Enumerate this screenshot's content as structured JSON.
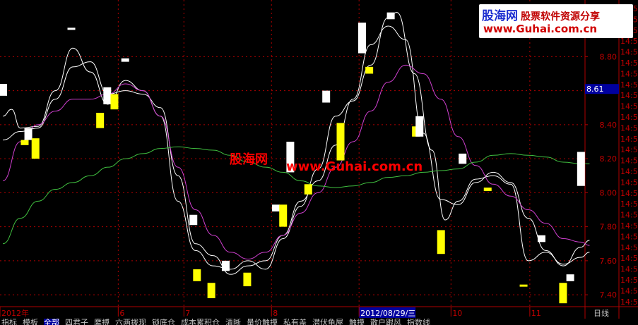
{
  "watermark": {
    "center_cn": "股海网",
    "center_url": "www.Guhai.com.cn",
    "logo_cn": "股海网",
    "logo_slogan": "股票软件资源分享",
    "logo_url": "www.Guhai.com.cn"
  },
  "right_panel": {
    "price_badge": "8.61",
    "period_label": "日线",
    "time_tick": "14:5"
  },
  "tabs": [
    "指标",
    "模板",
    "全部",
    "四君子",
    "鹰搏",
    "六两拨现",
    "锁底仓",
    "成本累积仓",
    "清晰",
    "量价触摸",
    "私有盖",
    "潜伏龟屋",
    "触摸",
    "散户跟风",
    "指数线"
  ],
  "active_tab": 2,
  "colors": {
    "background": "#000000",
    "axis": "#b00000",
    "ma_fast": "#ffffff",
    "ma_mid": "#ffffff",
    "ma_purple": "#d040d0",
    "ma_green": "#40c040",
    "bar_white": "#ffffff",
    "bar_yellow": "#ffff00",
    "axis_text": "#c00000",
    "badge_bg": "#0000a0"
  },
  "chart_data": {
    "type": "line",
    "y_ticks": [
      "8.80",
      "8.60",
      "8.40",
      "8.20",
      "8.00",
      "7.80",
      "7.60",
      "7.40"
    ],
    "ylim": [
      7.33,
      9.1
    ],
    "x_labels": [
      "2012年",
      "6",
      "7",
      "8",
      "2012/08/29/三",
      "10",
      "11"
    ],
    "x_label_positions": [
      0,
      27,
      42,
      62,
      82,
      103,
      121
    ],
    "n": 145,
    "series": [
      {
        "color": "#ffffff",
        "style": "fast",
        "points": [
          [
            0,
            8.45
          ],
          [
            2,
            8.49
          ],
          [
            4,
            8.38
          ],
          [
            8,
            8.39
          ],
          [
            12,
            8.6
          ],
          [
            16,
            8.85
          ],
          [
            20,
            8.71
          ],
          [
            24,
            8.52
          ],
          [
            28,
            8.66
          ],
          [
            32,
            8.6
          ],
          [
            36,
            8.45
          ],
          [
            40,
            7.95
          ],
          [
            44,
            7.66
          ],
          [
            48,
            7.57
          ],
          [
            52,
            7.55
          ],
          [
            56,
            7.6
          ],
          [
            60,
            7.55
          ],
          [
            64,
            7.73
          ],
          [
            68,
            7.92
          ],
          [
            72,
            8.14
          ],
          [
            76,
            8.45
          ],
          [
            80,
            8.54
          ],
          [
            84,
            8.75
          ],
          [
            88,
            9.03
          ],
          [
            90,
            9.06
          ],
          [
            94,
            8.7
          ],
          [
            98,
            8.25
          ],
          [
            101,
            7.84
          ],
          [
            104,
            7.95
          ],
          [
            108,
            8.08
          ],
          [
            112,
            8.1
          ],
          [
            116,
            8.05
          ],
          [
            120,
            7.6
          ],
          [
            124,
            7.65
          ],
          [
            128,
            7.58
          ],
          [
            132,
            7.62
          ],
          [
            134,
            7.65
          ]
        ]
      },
      {
        "color": "#ffffff",
        "style": "mid",
        "points": [
          [
            0,
            8.31
          ],
          [
            4,
            8.36
          ],
          [
            8,
            8.38
          ],
          [
            12,
            8.55
          ],
          [
            16,
            8.74
          ],
          [
            20,
            8.77
          ],
          [
            24,
            8.58
          ],
          [
            28,
            8.6
          ],
          [
            32,
            8.58
          ],
          [
            36,
            8.5
          ],
          [
            40,
            8.1
          ],
          [
            44,
            7.7
          ],
          [
            48,
            7.63
          ],
          [
            52,
            7.52
          ],
          [
            56,
            7.57
          ],
          [
            60,
            7.6
          ],
          [
            64,
            7.75
          ],
          [
            68,
            7.95
          ],
          [
            72,
            8.07
          ],
          [
            76,
            8.28
          ],
          [
            80,
            8.55
          ],
          [
            84,
            8.87
          ],
          [
            88,
            8.98
          ],
          [
            92,
            8.9
          ],
          [
            96,
            8.35
          ],
          [
            100,
            7.96
          ],
          [
            104,
            7.93
          ],
          [
            108,
            8.06
          ],
          [
            112,
            8.12
          ],
          [
            116,
            8.06
          ],
          [
            120,
            7.85
          ],
          [
            124,
            7.66
          ],
          [
            128,
            7.57
          ],
          [
            132,
            7.68
          ],
          [
            134,
            7.72
          ]
        ]
      },
      {
        "color": "#d040d0",
        "style": "slow",
        "points": [
          [
            0,
            8.07
          ],
          [
            4,
            8.3
          ],
          [
            8,
            8.4
          ],
          [
            12,
            8.48
          ],
          [
            16,
            8.55
          ],
          [
            20,
            8.55
          ],
          [
            24,
            8.58
          ],
          [
            28,
            8.64
          ],
          [
            32,
            8.6
          ],
          [
            36,
            8.45
          ],
          [
            40,
            8.15
          ],
          [
            44,
            7.9
          ],
          [
            48,
            7.75
          ],
          [
            52,
            7.65
          ],
          [
            56,
            7.61
          ],
          [
            60,
            7.65
          ],
          [
            64,
            7.75
          ],
          [
            68,
            7.88
          ],
          [
            72,
            8.0
          ],
          [
            76,
            8.15
          ],
          [
            80,
            8.3
          ],
          [
            84,
            8.48
          ],
          [
            88,
            8.65
          ],
          [
            92,
            8.75
          ],
          [
            96,
            8.7
          ],
          [
            100,
            8.55
          ],
          [
            104,
            8.33
          ],
          [
            108,
            8.16
          ],
          [
            112,
            8.05
          ],
          [
            116,
            7.98
          ],
          [
            120,
            7.9
          ],
          [
            124,
            7.82
          ],
          [
            128,
            7.73
          ],
          [
            132,
            7.71
          ],
          [
            134,
            7.69
          ]
        ]
      },
      {
        "color": "#40c040",
        "style": "long",
        "points": [
          [
            0,
            7.7
          ],
          [
            4,
            7.85
          ],
          [
            8,
            7.95
          ],
          [
            12,
            8.02
          ],
          [
            16,
            8.06
          ],
          [
            20,
            8.1
          ],
          [
            24,
            8.15
          ],
          [
            28,
            8.2
          ],
          [
            32,
            8.23
          ],
          [
            36,
            8.26
          ],
          [
            40,
            8.27
          ],
          [
            44,
            8.26
          ],
          [
            48,
            8.25
          ],
          [
            52,
            8.22
          ],
          [
            56,
            8.18
          ],
          [
            60,
            8.15
          ],
          [
            64,
            8.12
          ],
          [
            68,
            8.07
          ],
          [
            72,
            8.04
          ],
          [
            76,
            8.03
          ],
          [
            80,
            8.04
          ],
          [
            84,
            8.06
          ],
          [
            88,
            8.09
          ],
          [
            92,
            8.1
          ],
          [
            96,
            8.12
          ],
          [
            100,
            8.13
          ],
          [
            104,
            8.14
          ],
          [
            108,
            8.18
          ],
          [
            112,
            8.22
          ],
          [
            116,
            8.23
          ],
          [
            120,
            8.22
          ],
          [
            124,
            8.21
          ],
          [
            128,
            8.18
          ],
          [
            132,
            8.17
          ],
          [
            134,
            8.17
          ]
        ]
      }
    ],
    "bars": [
      {
        "i": 0,
        "top": 8.64,
        "bot": 8.57,
        "c": "w"
      },
      {
        "i": 6,
        "top": 8.31,
        "bot": 8.28,
        "c": "y"
      },
      {
        "i": 7,
        "top": 8.38,
        "bot": 8.31,
        "c": "w"
      },
      {
        "i": 9,
        "top": 8.32,
        "bot": 8.2,
        "c": "y"
      },
      {
        "i": 19,
        "top": 8.97,
        "bot": 8.96,
        "c": "w"
      },
      {
        "i": 27,
        "top": 8.47,
        "bot": 8.38,
        "c": "y"
      },
      {
        "i": 29,
        "top": 8.62,
        "bot": 8.52,
        "c": "w"
      },
      {
        "i": 31,
        "top": 8.58,
        "bot": 8.49,
        "c": "y"
      },
      {
        "i": 34,
        "top": 8.79,
        "bot": 8.77,
        "c": "w"
      },
      {
        "i": 53,
        "top": 7.87,
        "bot": 7.81,
        "c": "w"
      },
      {
        "i": 54,
        "top": 7.55,
        "bot": 7.48,
        "c": "y"
      },
      {
        "i": 58,
        "top": 7.47,
        "bot": 7.38,
        "c": "y"
      },
      {
        "i": 62,
        "top": 7.6,
        "bot": 7.54,
        "c": "w"
      },
      {
        "i": 68,
        "top": 7.53,
        "bot": 7.45,
        "c": "y"
      },
      {
        "i": 76,
        "top": 7.93,
        "bot": 7.89,
        "c": "w"
      },
      {
        "i": 78,
        "top": 7.93,
        "bot": 7.8,
        "c": "y"
      },
      {
        "i": 80,
        "top": 8.3,
        "bot": 8.12,
        "c": "w"
      },
      {
        "i": 85,
        "top": 8.05,
        "bot": 7.99,
        "c": "y"
      },
      {
        "i": 90,
        "top": 8.6,
        "bot": 8.53,
        "c": "w"
      },
      {
        "i": 94,
        "top": 8.41,
        "bot": 8.19,
        "c": "y"
      },
      {
        "i": 100,
        "top": 9.0,
        "bot": 8.82,
        "c": "w"
      },
      {
        "i": 102,
        "top": 8.74,
        "bot": 8.7,
        "c": "y"
      },
      {
        "i": 108,
        "top": 9.06,
        "bot": 9.02,
        "c": "w"
      },
      {
        "i": 115,
        "top": 8.39,
        "bot": 8.33,
        "c": "y"
      },
      {
        "i": 116,
        "top": 8.45,
        "bot": 8.33,
        "c": "w"
      },
      {
        "i": 122,
        "top": 7.78,
        "bot": 7.64,
        "c": "y"
      },
      {
        "i": 128,
        "top": 8.23,
        "bot": 8.17,
        "c": "w"
      },
      {
        "i": 135,
        "top": 8.03,
        "bot": 8.01,
        "c": "y"
      },
      {
        "i": 145,
        "top": 7.46,
        "bot": 7.45,
        "c": "y"
      },
      {
        "i": 150,
        "top": 7.75,
        "bot": 7.71,
        "c": "w"
      },
      {
        "i": 156,
        "top": 7.47,
        "bot": 7.35,
        "c": "y"
      },
      {
        "i": 158,
        "top": 7.52,
        "bot": 7.48,
        "c": "w"
      },
      {
        "i": 161,
        "top": 8.24,
        "bot": 8.04,
        "c": "w"
      }
    ]
  }
}
